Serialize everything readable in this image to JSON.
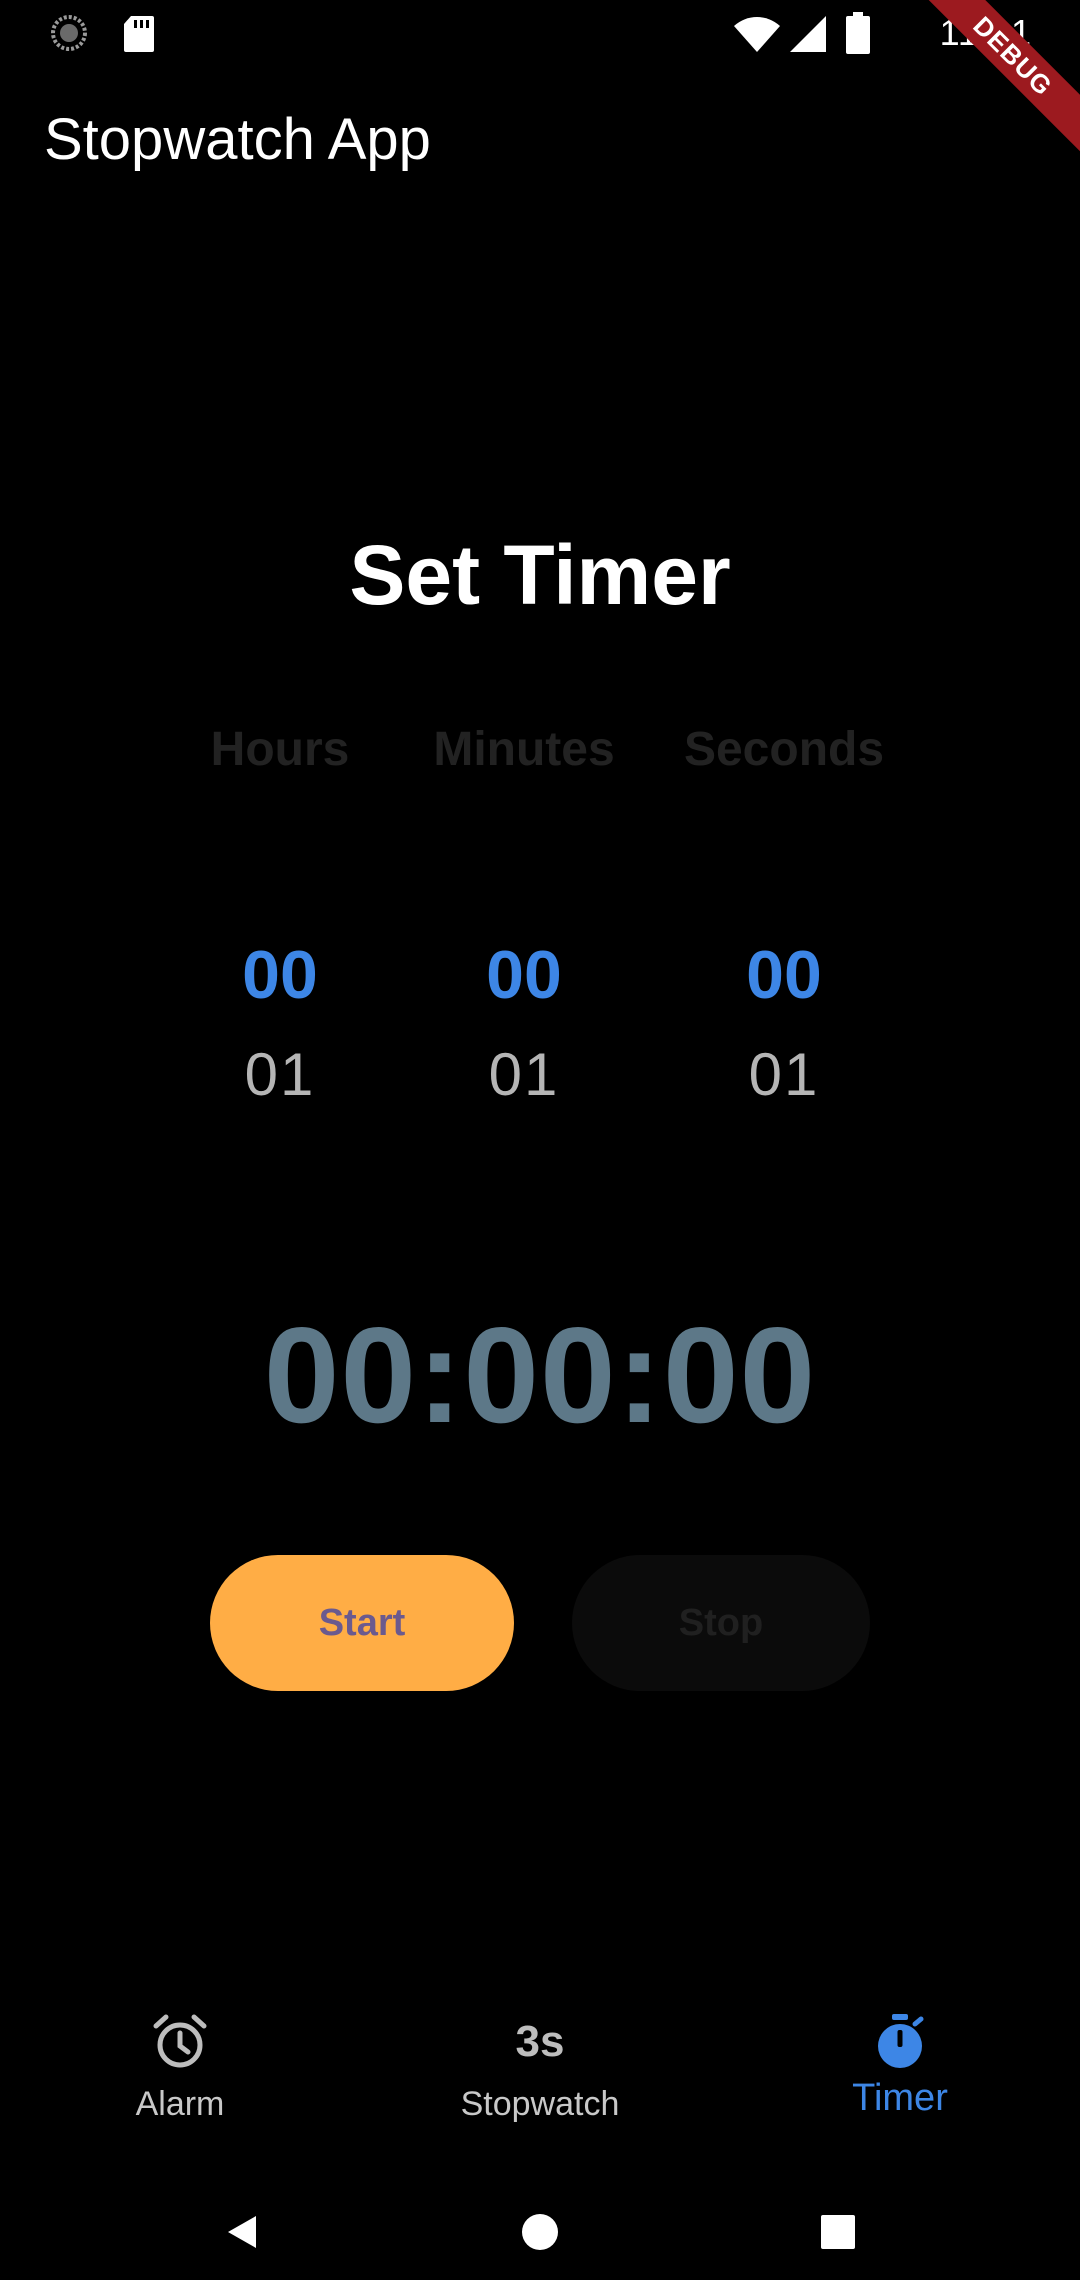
{
  "status_bar": {
    "time": "11:21",
    "icons": [
      "sync-icon",
      "sd-card-icon",
      "wifi-icon",
      "signal-icon",
      "battery-icon"
    ]
  },
  "debug_banner": "DEBUG",
  "app_bar": {
    "title": "Stopwatch App"
  },
  "timer": {
    "title": "Set Timer",
    "columns": [
      {
        "label": "Hours",
        "selected": "00",
        "next": "01"
      },
      {
        "label": "Minutes",
        "selected": "00",
        "next": "01"
      },
      {
        "label": "Seconds",
        "selected": "00",
        "next": "01"
      }
    ],
    "display": "00:00:00",
    "start_label": "Start",
    "stop_label": "Stop"
  },
  "bottom_nav": {
    "items": [
      {
        "label": "Alarm",
        "icon": "alarm-clock-icon"
      },
      {
        "label": "Stopwatch",
        "badge": "3s"
      },
      {
        "label": "Timer",
        "icon": "timer-icon",
        "active": true
      }
    ]
  },
  "system_nav": {
    "icons": [
      "back-icon",
      "home-icon",
      "recents-icon"
    ]
  },
  "colors": {
    "background": "#000000",
    "accent_blue": "#3d86e6",
    "start_button": "#ffad45",
    "start_text": "#6b5a8e",
    "time_display": "#5d7888",
    "debug_ribbon": "#9c1a1f"
  }
}
